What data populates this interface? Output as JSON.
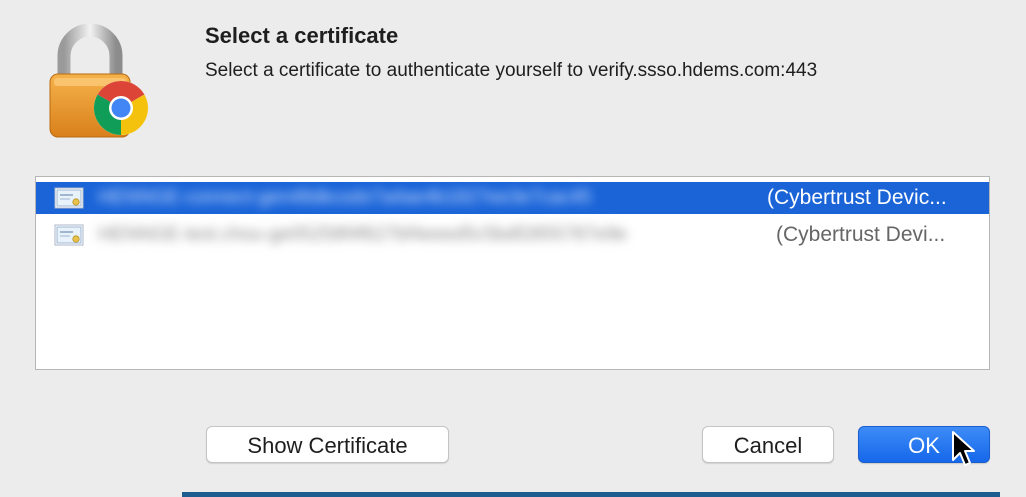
{
  "dialog": {
    "title": "Select a certificate",
    "message": "Select a certificate to authenticate yourself to verify.ssso.hdems.com:443",
    "icon": "lock-chrome-icon"
  },
  "certificates": [
    {
      "name": "HENNGE-connect-gen48dkcodx7a4ae4b1827ee3e7cac45",
      "issuer": "(Cybertrust Devic...",
      "selected": true,
      "icon": "certificate-icon"
    },
    {
      "name": "HENNGE-test.chou-ge05258f4f627bf4eeed5c5bdf2855787e9e",
      "issuer": "(Cybertrust Devi...",
      "selected": false,
      "icon": "certificate-icon"
    }
  ],
  "buttons": {
    "show_certificate": "Show Certificate",
    "cancel": "Cancel",
    "ok": "OK"
  },
  "colors": {
    "selection": "#1a64d8",
    "primary_button": "#1667ea",
    "dialog_background": "#ececec"
  }
}
